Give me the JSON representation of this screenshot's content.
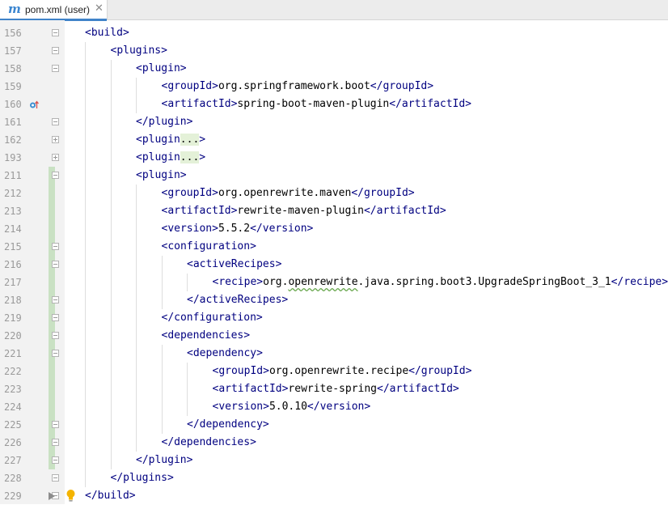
{
  "tab": {
    "label": "pom.xml (user)",
    "icon": "maven-m-icon",
    "close_label": "✕",
    "icon_glyph": "m"
  },
  "colors": {
    "tag": "#000080",
    "text": "#000000",
    "line_number": "#9a9a9a",
    "change_marker": "#c9e1c3",
    "collapsed_bg": "#e4f1d8",
    "tab_accent": "#4083c9",
    "gutter": "#f2f2f2"
  },
  "lines": [
    {
      "num": "156",
      "indent": 0,
      "parts": [
        [
          "t",
          "<build>"
        ]
      ],
      "fold": "minus",
      "changed": false
    },
    {
      "num": "157",
      "indent": 1,
      "parts": [
        [
          "t",
          "<plugins>"
        ]
      ],
      "fold": "minus",
      "changed": false
    },
    {
      "num": "158",
      "indent": 2,
      "parts": [
        [
          "t",
          "<plugin>"
        ]
      ],
      "fold": "minus",
      "changed": false
    },
    {
      "num": "159",
      "indent": 3,
      "parts": [
        [
          "t",
          "<groupId>"
        ],
        [
          "x",
          "org.springframework.boot"
        ],
        [
          "t",
          "</groupId>"
        ]
      ],
      "fold": "",
      "changed": false
    },
    {
      "num": "160",
      "indent": 3,
      "parts": [
        [
          "t",
          "<artifactId>"
        ],
        [
          "x",
          "spring-boot-maven-plugin"
        ],
        [
          "t",
          "</artifactId>"
        ]
      ],
      "fold": "",
      "changed": false,
      "marker": "override-up-icon"
    },
    {
      "num": "161",
      "indent": 2,
      "parts": [
        [
          "t",
          "</plugin>"
        ]
      ],
      "fold": "minus",
      "changed": false
    },
    {
      "num": "162",
      "indent": 2,
      "parts": [
        [
          "t",
          "<plugin"
        ],
        [
          "c",
          "..."
        ],
        [
          "t",
          ">"
        ]
      ],
      "fold": "plus",
      "changed": false
    },
    {
      "num": "193",
      "indent": 2,
      "parts": [
        [
          "t",
          "<plugin"
        ],
        [
          "c",
          "..."
        ],
        [
          "t",
          ">"
        ]
      ],
      "fold": "plus",
      "changed": false
    },
    {
      "num": "211",
      "indent": 2,
      "parts": [
        [
          "t",
          "<plugin>"
        ]
      ],
      "fold": "minus",
      "changed": true
    },
    {
      "num": "212",
      "indent": 3,
      "parts": [
        [
          "t",
          "<groupId>"
        ],
        [
          "x",
          "org.openrewrite.maven"
        ],
        [
          "t",
          "</groupId>"
        ]
      ],
      "fold": "",
      "changed": true
    },
    {
      "num": "213",
      "indent": 3,
      "parts": [
        [
          "t",
          "<artifactId>"
        ],
        [
          "x",
          "rewrite-maven-plugin"
        ],
        [
          "t",
          "</artifactId>"
        ]
      ],
      "fold": "",
      "changed": true
    },
    {
      "num": "214",
      "indent": 3,
      "parts": [
        [
          "t",
          "<version>"
        ],
        [
          "x",
          "5.5.2"
        ],
        [
          "t",
          "</version>"
        ]
      ],
      "fold": "",
      "changed": true
    },
    {
      "num": "215",
      "indent": 3,
      "parts": [
        [
          "t",
          "<configuration>"
        ]
      ],
      "fold": "minus",
      "changed": true
    },
    {
      "num": "216",
      "indent": 4,
      "parts": [
        [
          "t",
          "<activeRecipes>"
        ]
      ],
      "fold": "minus",
      "changed": true
    },
    {
      "num": "217",
      "indent": 5,
      "parts": [
        [
          "t",
          "<recipe>"
        ],
        [
          "x",
          "org."
        ],
        [
          "s",
          "openrewrite"
        ],
        [
          "x",
          ".java.spring.boot3.UpgradeSpringBoot_3_1"
        ],
        [
          "t",
          "</recipe>"
        ]
      ],
      "fold": "",
      "changed": true
    },
    {
      "num": "218",
      "indent": 4,
      "parts": [
        [
          "t",
          "</activeRecipes>"
        ]
      ],
      "fold": "minus",
      "changed": true
    },
    {
      "num": "219",
      "indent": 3,
      "parts": [
        [
          "t",
          "</configuration>"
        ]
      ],
      "fold": "minus",
      "changed": true
    },
    {
      "num": "220",
      "indent": 3,
      "parts": [
        [
          "t",
          "<dependencies>"
        ]
      ],
      "fold": "minus",
      "changed": true
    },
    {
      "num": "221",
      "indent": 4,
      "parts": [
        [
          "t",
          "<dependency>"
        ]
      ],
      "fold": "minus",
      "changed": true
    },
    {
      "num": "222",
      "indent": 5,
      "parts": [
        [
          "t",
          "<groupId>"
        ],
        [
          "x",
          "org.openrewrite.recipe"
        ],
        [
          "t",
          "</groupId>"
        ]
      ],
      "fold": "",
      "changed": true
    },
    {
      "num": "223",
      "indent": 5,
      "parts": [
        [
          "t",
          "<artifactId>"
        ],
        [
          "x",
          "rewrite-spring"
        ],
        [
          "t",
          "</artifactId>"
        ]
      ],
      "fold": "",
      "changed": true
    },
    {
      "num": "224",
      "indent": 5,
      "parts": [
        [
          "t",
          "<version>"
        ],
        [
          "x",
          "5.0.10"
        ],
        [
          "t",
          "</version>"
        ]
      ],
      "fold": "",
      "changed": true
    },
    {
      "num": "225",
      "indent": 4,
      "parts": [
        [
          "t",
          "</dependency>"
        ]
      ],
      "fold": "minus",
      "changed": true
    },
    {
      "num": "226",
      "indent": 3,
      "parts": [
        [
          "t",
          "</dependencies>"
        ]
      ],
      "fold": "minus",
      "changed": true
    },
    {
      "num": "227",
      "indent": 2,
      "parts": [
        [
          "t",
          "</plugin>"
        ]
      ],
      "fold": "minus",
      "changed": true
    },
    {
      "num": "228",
      "indent": 1,
      "parts": [
        [
          "t",
          "</plugins>"
        ]
      ],
      "fold": "minus",
      "changed": false
    },
    {
      "num": "229",
      "indent": 0,
      "parts": [
        [
          "t",
          "</build>"
        ]
      ],
      "fold": "minus",
      "changed": false,
      "marker": "lightbulb-icon",
      "caret_marker": "play-triangle-icon"
    }
  ]
}
